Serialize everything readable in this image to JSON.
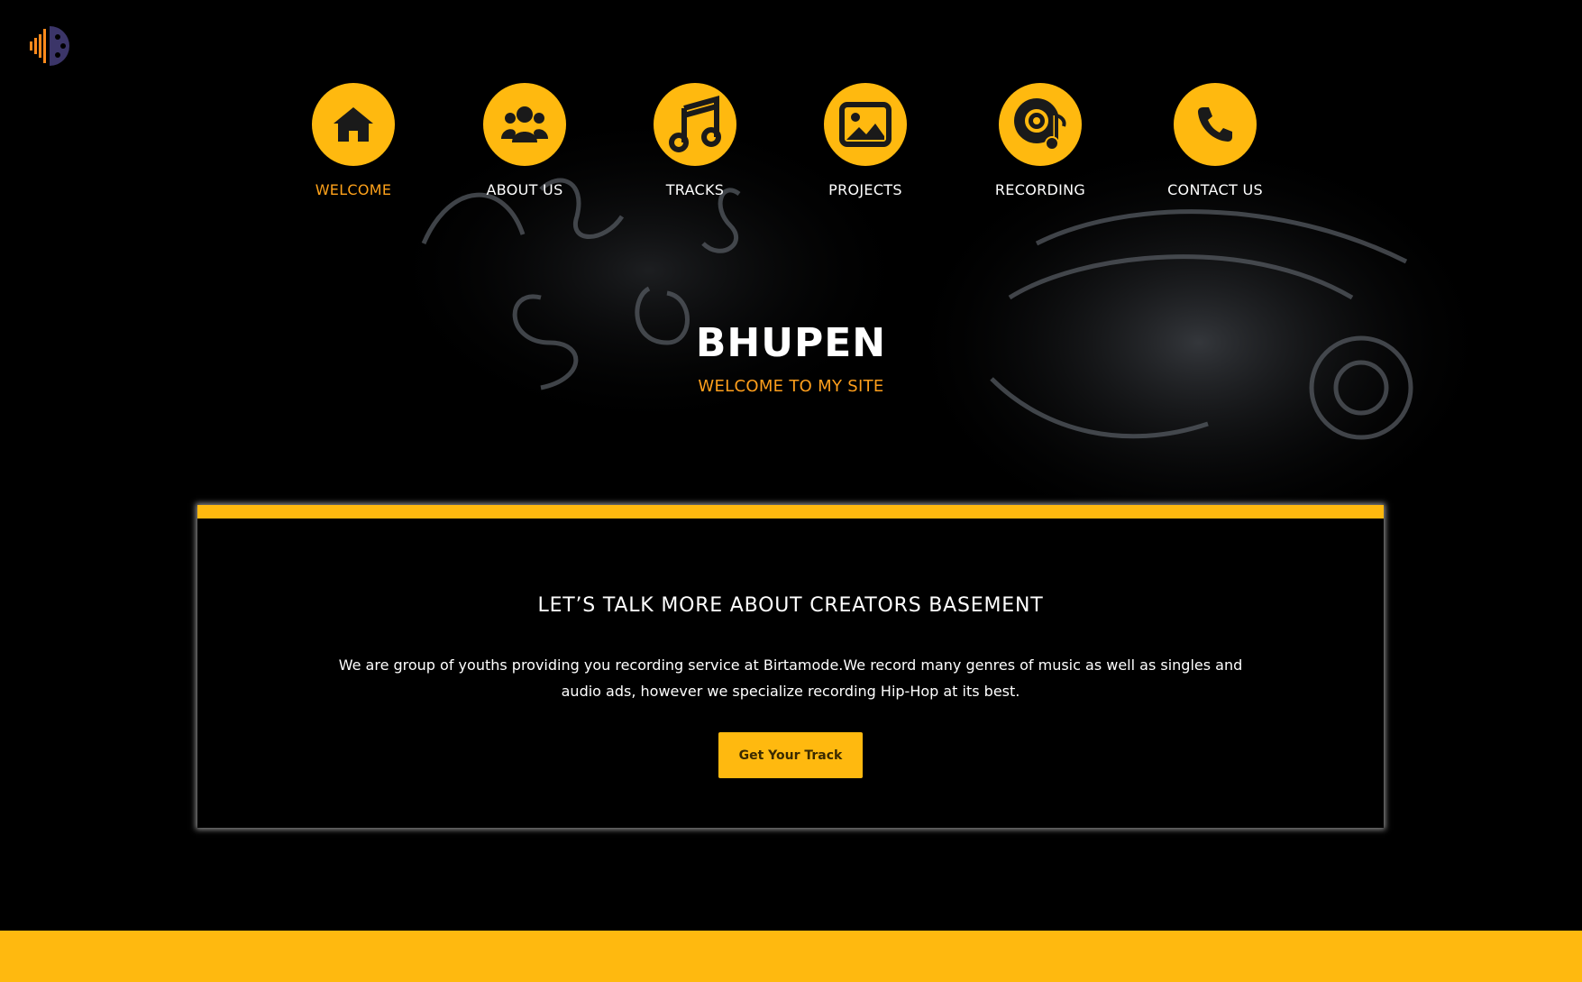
{
  "colors": {
    "accent": "#ffb90f",
    "active_nav": "#ffa21a",
    "subtitle": "#ff9f1c",
    "background": "#000000",
    "text": "#ffffff"
  },
  "logo": {
    "icon": "sound-wave-logo-icon"
  },
  "nav": {
    "items": [
      {
        "label": "WELCOME",
        "icon": "home-icon",
        "active": true
      },
      {
        "label": "ABOUT US",
        "icon": "users-icon",
        "active": false
      },
      {
        "label": "TRACKS",
        "icon": "music-note-icon",
        "active": false
      },
      {
        "label": "PROJECTS",
        "icon": "image-icon",
        "active": false
      },
      {
        "label": "RECORDING",
        "icon": "vinyl-record-icon",
        "active": false
      },
      {
        "label": "CONTACT US",
        "icon": "phone-icon",
        "active": false
      }
    ]
  },
  "hero": {
    "title": "BHUPEN",
    "subtitle": "WELCOME TO MY SITE"
  },
  "about": {
    "title": "LET’S TALK MORE ABOUT CREATORS BASEMENT",
    "body": "We are group of youths providing you recording service at Birtamode.We record many genres of music as well as singles and audio ads, however we specialize recording Hip-Hop at its best.",
    "button_label": "Get Your Track"
  }
}
